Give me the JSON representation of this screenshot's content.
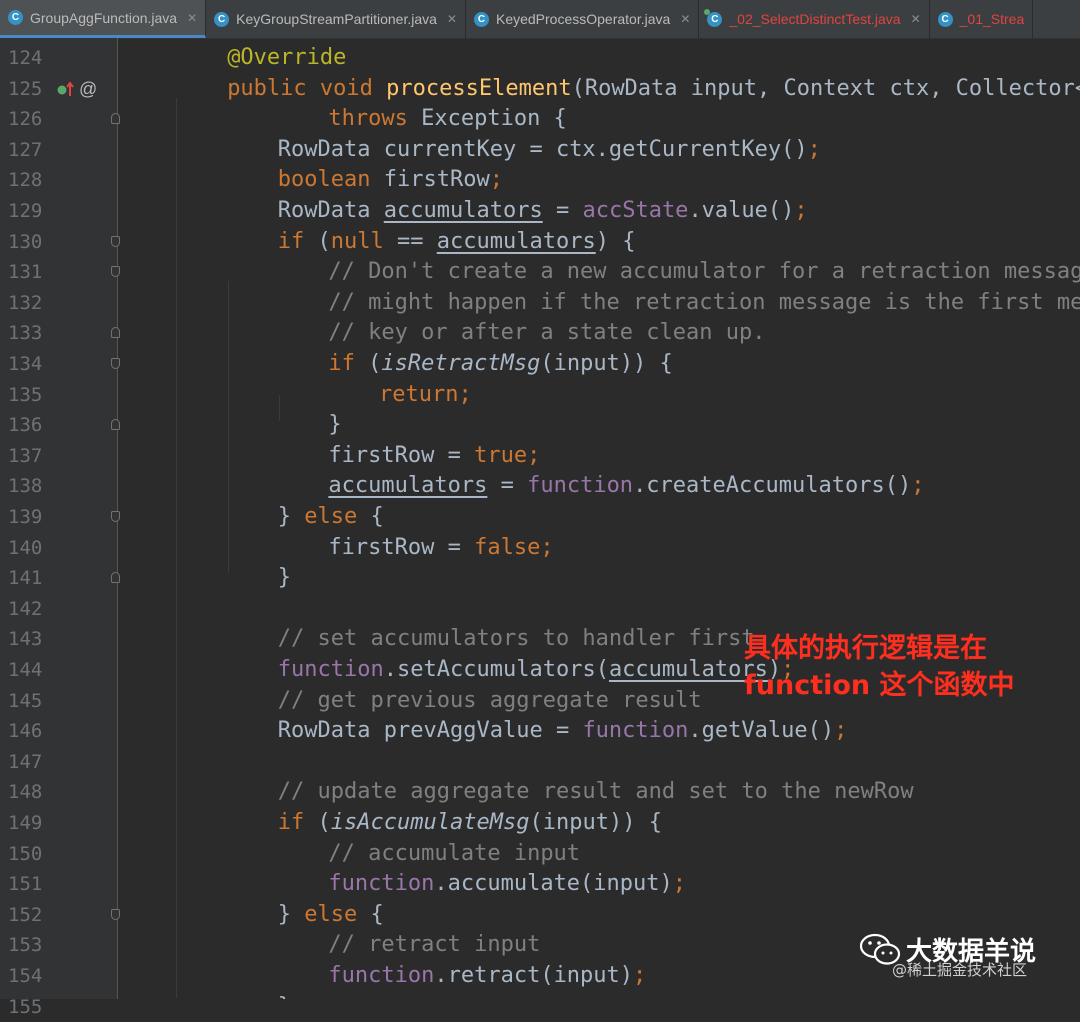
{
  "colors": {
    "background": "#2b2b2b",
    "gutter": "#313335",
    "keyword": "#cc7832",
    "annotation": "#bbb529",
    "method_declaration": "#ffc66d",
    "comment": "#808080",
    "field": "#9876aa",
    "plain": "#a9b7c6",
    "callout": "#ff2f1f"
  },
  "tabs": [
    {
      "label": "GroupAggFunction.java",
      "active": true,
      "icon": "class-icon",
      "closable": true
    },
    {
      "label": "KeyGroupStreamPartitioner.java",
      "active": false,
      "icon": "class-icon",
      "closable": true
    },
    {
      "label": "KeyedProcessOperator.java",
      "active": false,
      "icon": "class-icon",
      "closable": true
    },
    {
      "label": "_02_SelectDistinctTest.java",
      "active": false,
      "icon": "runnable-class-icon",
      "closable": true,
      "error": true
    },
    {
      "label": "_01_Strea",
      "active": false,
      "icon": "class-icon",
      "closable": false,
      "error": true
    }
  ],
  "gutter_markers": {
    "override_icon": "override-up-arrow-icon",
    "at_sign": "@"
  },
  "code_lines": [
    {
      "num": "124",
      "indent": 2,
      "fold": "",
      "tokens": [
        {
          "t": "@Override",
          "c": "ann"
        }
      ]
    },
    {
      "num": "125",
      "indent": 2,
      "fold": "",
      "marker": true,
      "tokens": [
        {
          "t": "public ",
          "c": "kw"
        },
        {
          "t": "void ",
          "c": "kw"
        },
        {
          "t": "processElement",
          "c": "fn"
        },
        {
          "t": "(RowData input, Context ctx, Collector<RowDat",
          "c": "plain"
        }
      ]
    },
    {
      "num": "126",
      "indent": 4,
      "fold": "end",
      "tokens": [
        {
          "t": "throws ",
          "c": "kw"
        },
        {
          "t": "Exception {",
          "c": "plain"
        }
      ]
    },
    {
      "num": "127",
      "indent": 3,
      "fold": "",
      "tokens": [
        {
          "t": "RowData currentKey = ctx.getCurrentKey()",
          "c": "plain"
        },
        {
          "t": ";",
          "c": "kw"
        }
      ]
    },
    {
      "num": "128",
      "indent": 3,
      "fold": "",
      "tokens": [
        {
          "t": "boolean ",
          "c": "kw"
        },
        {
          "t": "firstRow",
          "c": "plain"
        },
        {
          "t": ";",
          "c": "kw"
        }
      ]
    },
    {
      "num": "129",
      "indent": 3,
      "fold": "",
      "tokens": [
        {
          "t": "RowData ",
          "c": "plain"
        },
        {
          "t": "accumulators",
          "c": "plain",
          "ul": true
        },
        {
          "t": " = ",
          "c": "plain"
        },
        {
          "t": "accState",
          "c": "field"
        },
        {
          "t": ".value()",
          "c": "plain"
        },
        {
          "t": ";",
          "c": "kw"
        }
      ]
    },
    {
      "num": "130",
      "indent": 3,
      "fold": "start",
      "tokens": [
        {
          "t": "if ",
          "c": "kw"
        },
        {
          "t": "(",
          "c": "plain"
        },
        {
          "t": "null",
          "c": "kw"
        },
        {
          "t": " == ",
          "c": "plain"
        },
        {
          "t": "accumulators",
          "c": "plain",
          "ul": true
        },
        {
          "t": ") {",
          "c": "plain"
        }
      ]
    },
    {
      "num": "131",
      "indent": 4,
      "fold": "start",
      "tokens": [
        {
          "t": "// Don't create a new accumulator for a retraction message. Thi",
          "c": "com"
        }
      ]
    },
    {
      "num": "132",
      "indent": 4,
      "fold": "",
      "tokens": [
        {
          "t": "// might happen if the retraction message is the first message",
          "c": "com"
        }
      ]
    },
    {
      "num": "133",
      "indent": 4,
      "fold": "end",
      "tokens": [
        {
          "t": "// key or after a state clean up.",
          "c": "com"
        }
      ]
    },
    {
      "num": "134",
      "indent": 4,
      "fold": "start",
      "tokens": [
        {
          "t": "if ",
          "c": "kw"
        },
        {
          "t": "(",
          "c": "plain"
        },
        {
          "t": "isRetractMsg",
          "c": "plain",
          "italic": true
        },
        {
          "t": "(input)) {",
          "c": "plain"
        }
      ]
    },
    {
      "num": "135",
      "indent": 5,
      "fold": "",
      "tokens": [
        {
          "t": "return",
          "c": "kw"
        },
        {
          "t": ";",
          "c": "kw"
        }
      ]
    },
    {
      "num": "136",
      "indent": 4,
      "fold": "end",
      "tokens": [
        {
          "t": "}",
          "c": "plain"
        }
      ]
    },
    {
      "num": "137",
      "indent": 4,
      "fold": "",
      "tokens": [
        {
          "t": "firstRow = ",
          "c": "plain"
        },
        {
          "t": "true",
          "c": "kw"
        },
        {
          "t": ";",
          "c": "kw"
        }
      ]
    },
    {
      "num": "138",
      "indent": 4,
      "fold": "",
      "tokens": [
        {
          "t": "accumulators",
          "c": "plain",
          "ul": true
        },
        {
          "t": " = ",
          "c": "plain"
        },
        {
          "t": "function",
          "c": "field"
        },
        {
          "t": ".createAccumulators()",
          "c": "plain"
        },
        {
          "t": ";",
          "c": "kw"
        }
      ]
    },
    {
      "num": "139",
      "indent": 3,
      "fold": "start",
      "tokens": [
        {
          "t": "} ",
          "c": "plain"
        },
        {
          "t": "else ",
          "c": "kw"
        },
        {
          "t": "{",
          "c": "plain"
        }
      ]
    },
    {
      "num": "140",
      "indent": 4,
      "fold": "",
      "tokens": [
        {
          "t": "firstRow = ",
          "c": "plain"
        },
        {
          "t": "false",
          "c": "kw"
        },
        {
          "t": ";",
          "c": "kw"
        }
      ]
    },
    {
      "num": "141",
      "indent": 3,
      "fold": "end",
      "tokens": [
        {
          "t": "}",
          "c": "plain"
        }
      ]
    },
    {
      "num": "142",
      "indent": 3,
      "fold": "",
      "tokens": []
    },
    {
      "num": "143",
      "indent": 3,
      "fold": "",
      "tokens": [
        {
          "t": "// set accumulators to handler first",
          "c": "com"
        }
      ]
    },
    {
      "num": "144",
      "indent": 3,
      "fold": "",
      "tokens": [
        {
          "t": "function",
          "c": "field"
        },
        {
          "t": ".setAccumulators(",
          "c": "plain"
        },
        {
          "t": "accumulators",
          "c": "plain",
          "ul": true
        },
        {
          "t": ")",
          "c": "plain"
        },
        {
          "t": ";",
          "c": "kw"
        }
      ]
    },
    {
      "num": "145",
      "indent": 3,
      "fold": "",
      "tokens": [
        {
          "t": "// get previous aggregate result",
          "c": "com"
        }
      ]
    },
    {
      "num": "146",
      "indent": 3,
      "fold": "",
      "tokens": [
        {
          "t": "RowData prevAggValue = ",
          "c": "plain"
        },
        {
          "t": "function",
          "c": "field"
        },
        {
          "t": ".getValue()",
          "c": "plain"
        },
        {
          "t": ";",
          "c": "kw"
        }
      ]
    },
    {
      "num": "147",
      "indent": 3,
      "fold": "",
      "tokens": []
    },
    {
      "num": "148",
      "indent": 3,
      "fold": "",
      "tokens": [
        {
          "t": "// update aggregate result and set to the newRow",
          "c": "com"
        }
      ]
    },
    {
      "num": "149",
      "indent": 3,
      "fold": "",
      "tokens": [
        {
          "t": "if ",
          "c": "kw"
        },
        {
          "t": "(",
          "c": "plain"
        },
        {
          "t": "isAccumulateMsg",
          "c": "plain",
          "italic": true
        },
        {
          "t": "(input)) {",
          "c": "plain"
        }
      ]
    },
    {
      "num": "150",
      "indent": 4,
      "fold": "",
      "tokens": [
        {
          "t": "// accumulate input",
          "c": "com"
        }
      ]
    },
    {
      "num": "151",
      "indent": 4,
      "fold": "",
      "tokens": [
        {
          "t": "function",
          "c": "field"
        },
        {
          "t": ".accumulate(input)",
          "c": "plain"
        },
        {
          "t": ";",
          "c": "kw"
        }
      ]
    },
    {
      "num": "152",
      "indent": 3,
      "fold": "start",
      "tokens": [
        {
          "t": "} ",
          "c": "plain"
        },
        {
          "t": "else ",
          "c": "kw"
        },
        {
          "t": "{",
          "c": "plain"
        }
      ]
    },
    {
      "num": "153",
      "indent": 4,
      "fold": "",
      "tokens": [
        {
          "t": "// retract input",
          "c": "com"
        }
      ]
    },
    {
      "num": "154",
      "indent": 4,
      "fold": "",
      "tokens": [
        {
          "t": "function",
          "c": "field"
        },
        {
          "t": ".retract(input)",
          "c": "plain"
        },
        {
          "t": ";",
          "c": "kw"
        }
      ]
    },
    {
      "num": "155",
      "indent": 3,
      "fold": "",
      "tokens": [
        {
          "t": "}",
          "c": "plain"
        }
      ]
    }
  ],
  "callout": {
    "line1": "具体的执行逻辑是在",
    "line2": "function 这个函数中"
  },
  "watermark": {
    "brand": "大数据羊说",
    "sub": "@稀土掘金技术社区",
    "icon": "wechat-icon"
  }
}
